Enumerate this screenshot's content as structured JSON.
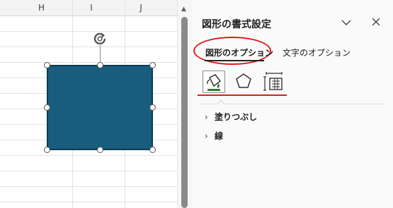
{
  "sheet": {
    "columns": [
      "H",
      "I",
      "J"
    ],
    "shape_fill": "#195d7e"
  },
  "pane": {
    "title": "図形の書式設定",
    "tabs": [
      {
        "label": "図形のオプション",
        "selected": true
      },
      {
        "label": "文字のオプション",
        "selected": false
      }
    ],
    "icons": [
      "fill-and-line-icon",
      "effects-pentagon-icon",
      "size-and-properties-icon"
    ],
    "sections": [
      {
        "label": "塗りつぶし",
        "chevron": "›"
      },
      {
        "label": "線",
        "chevron": "›"
      }
    ],
    "annotation_color": "#e11b1b"
  }
}
